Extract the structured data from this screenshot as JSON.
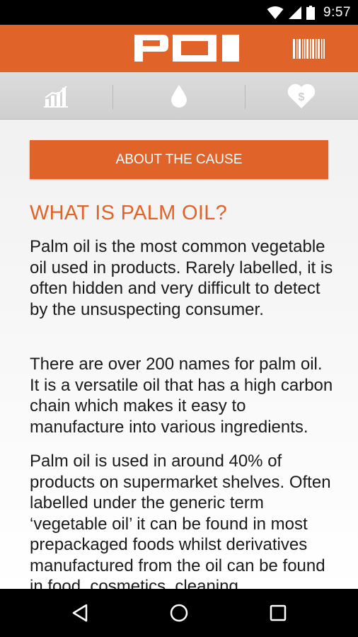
{
  "status_bar": {
    "time": "9:57",
    "icons": [
      "wifi-icon",
      "cell-signal-icon",
      "battery-icon"
    ]
  },
  "app_bar": {
    "logo_text": "POI",
    "action_icon": "barcode-icon"
  },
  "tabs": [
    {
      "icon": "stats-chart-icon",
      "selected": false
    },
    {
      "icon": "drop-icon",
      "selected": true
    },
    {
      "icon": "heart-dollar-icon",
      "selected": false
    }
  ],
  "content": {
    "cause_button_label": "ABOUT THE CAUSE",
    "heading": "WHAT IS PALM OIL?",
    "paragraphs": [
      "Palm oil is the most common vegetable oil used in products. Rarely labelled, it is often hidden and very difficult to detect by the unsuspecting consumer.",
      "There are over 200 names for palm oil.  It is a versatile oil that has a high carbon chain which makes it easy to manufacture into various ingredients.",
      "Palm oil is used in around 40% of products on supermarket shelves. Often labelled under the generic term ‘vegetable oil’ it can be found in most prepackaged foods whilst derivatives manufactured from the oil can be found in food, cosmetics, cleaning"
    ]
  },
  "nav_bar": {
    "icons": [
      "back-icon",
      "home-icon",
      "recents-icon"
    ]
  },
  "colors": {
    "accent": "#e0642a",
    "status_bar": "#000000",
    "tab_bar": "#d6d6d6",
    "body_text": "#1a1a1a"
  }
}
